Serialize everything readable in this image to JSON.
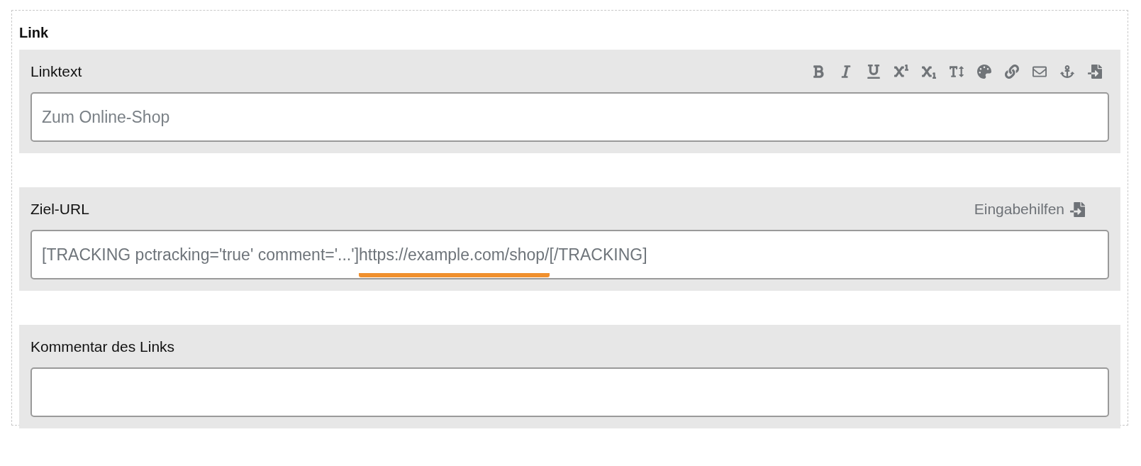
{
  "section": {
    "title": "Link"
  },
  "fields": [
    {
      "kind": "text",
      "label": "Linktext",
      "toolbar": true,
      "placeholder": "Zum Online-Shop"
    },
    {
      "kind": "segments",
      "label": "Ziel-URL",
      "helper": "Eingabehilfen",
      "segments": [
        {
          "text": "[TRACKING pctracking='true' comment='...']",
          "marked": false
        },
        {
          "text": "https://example.com/shop/",
          "marked": true
        },
        {
          "text": "[/TRACKING]",
          "marked": false
        }
      ]
    },
    {
      "kind": "text",
      "label": "Kommentar des Links"
    }
  ]
}
